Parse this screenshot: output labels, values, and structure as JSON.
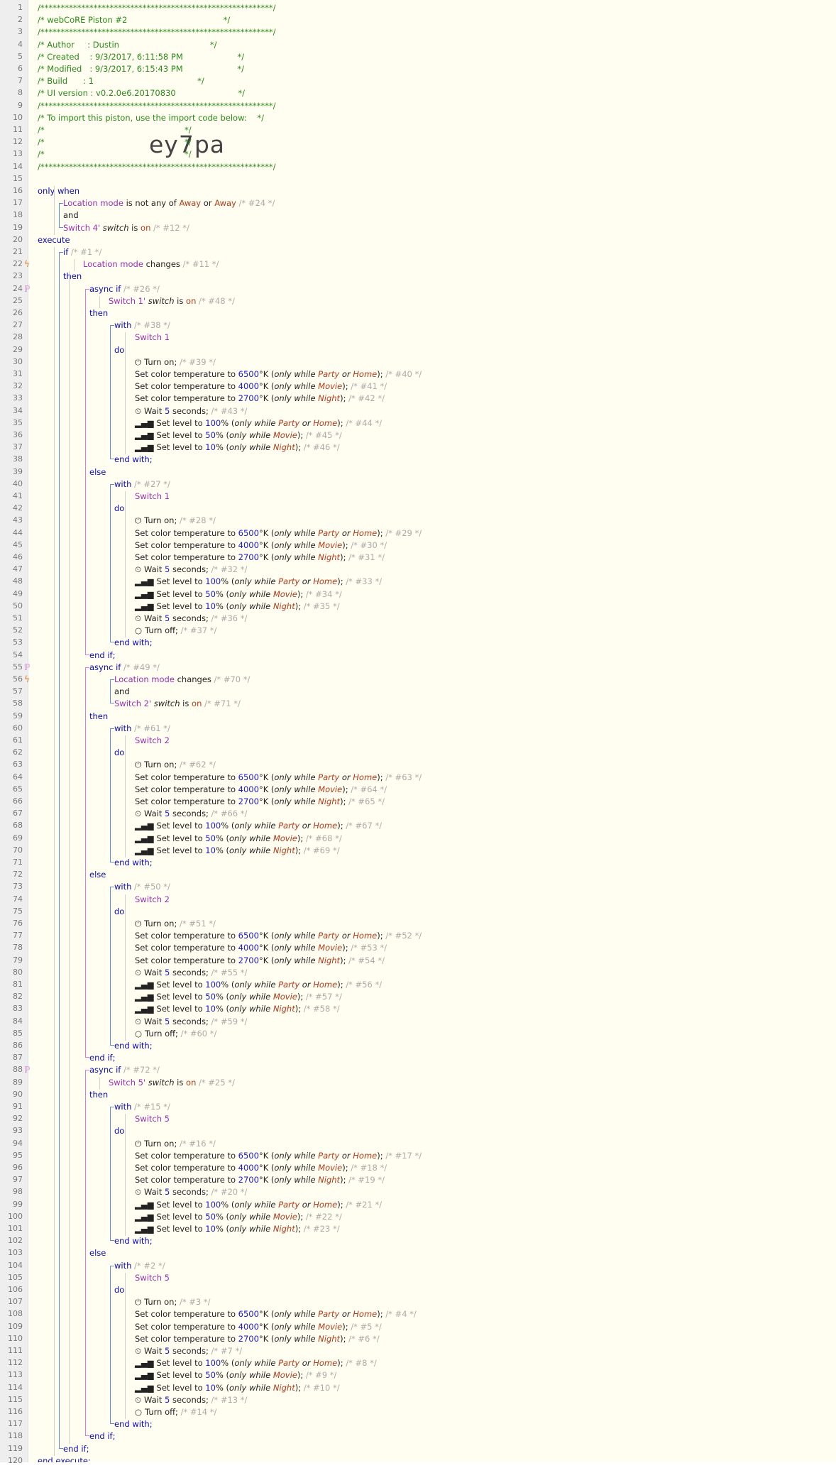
{
  "import_code": "ey7pa",
  "colors": {
    "keyword": "#0a0ab8",
    "device": "#9a2fb2",
    "value": "#b23a1c",
    "comment": "#aaaaaa",
    "header": "#2a8a1a",
    "block": "#5a8fd0",
    "async": "#d87fcf"
  },
  "lines": [
    {
      "n": 1,
      "t": "/*********************************************************/",
      "c": "gr"
    },
    {
      "n": 2,
      "t": "/* webCoRE Piston #2                                     */",
      "c": "gr"
    },
    {
      "n": 3,
      "t": "/*********************************************************/",
      "c": "gr"
    },
    {
      "n": 4,
      "t": "/* Author     : Dustin                                   */",
      "c": "gr"
    },
    {
      "n": 5,
      "t": "/* Created    : 9/3/2017, 6:11:58 PM                     */",
      "c": "gr"
    },
    {
      "n": 6,
      "t": "/* Modified   : 9/3/2017, 6:15:43 PM                     */",
      "c": "gr"
    },
    {
      "n": 7,
      "t": "/* Build      : 1                                        */",
      "c": "gr"
    },
    {
      "n": 8,
      "t": "/* UI version : v0.2.0e6.20170830                        */",
      "c": "gr"
    },
    {
      "n": 9,
      "t": "/*********************************************************/",
      "c": "gr"
    },
    {
      "n": 10,
      "t": "/* To import this piston, use the import code below:    */",
      "c": "gr"
    },
    {
      "n": 11,
      "t": "/*                                                      */",
      "c": "gr"
    },
    {
      "n": 12,
      "t": "/*                                                      */",
      "c": "gr"
    },
    {
      "n": 13,
      "t": "/*                                                      */",
      "c": "gr"
    },
    {
      "n": 14,
      "t": "/*********************************************************/",
      "c": "gr"
    },
    {
      "n": 15,
      "t": ""
    },
    {
      "n": 16,
      "t": "only when",
      "c": "kw"
    },
    {
      "n": 17,
      "t": "Location mode|is not any of|Away|or|Away|/* #24 */"
    },
    {
      "n": 18,
      "t": "and"
    },
    {
      "n": 19,
      "t": "Switch 4' switch|is|on|/* #12 */"
    },
    {
      "n": 20,
      "t": "execute",
      "c": "kw"
    },
    {
      "n": 21,
      "t": "if|/* #1 */"
    },
    {
      "n": 22,
      "t": "Location mode|changes|/* #11 */"
    },
    {
      "n": 23,
      "t": "then",
      "c": "kw"
    },
    {
      "n": 24,
      "t": "async if|/* #26 */"
    },
    {
      "n": 25,
      "t": "Switch 1' switch|is|on|/* #48 */"
    },
    {
      "n": 26,
      "t": "then",
      "c": "kw"
    },
    {
      "n": 27,
      "t": "with|/* #38 */"
    },
    {
      "n": 28,
      "t": "Switch 1",
      "c": "dev"
    },
    {
      "n": 29,
      "t": "do",
      "c": "kw"
    },
    {
      "n": 30,
      "t": "P|Turn on;|/* #39 */"
    },
    {
      "n": 31,
      "t": "CT|6500|Party|Home|/* #40 */"
    },
    {
      "n": 32,
      "t": "CT|4000|Movie||/* #41 */"
    },
    {
      "n": 33,
      "t": "CT|2700|Night||/* #42 */"
    },
    {
      "n": 34,
      "t": "W|5|/* #43 */"
    },
    {
      "n": 35,
      "t": "L|100|Party|Home|/* #44 */"
    },
    {
      "n": 36,
      "t": "L|50|Movie||/* #45 */"
    },
    {
      "n": 37,
      "t": "L|10|Night||/* #46 */"
    },
    {
      "n": 38,
      "t": "end with;",
      "c": "kw"
    },
    {
      "n": 39,
      "t": "else",
      "c": "kw"
    },
    {
      "n": 40,
      "t": "with|/* #27 */"
    },
    {
      "n": 41,
      "t": "Switch 1",
      "c": "dev"
    },
    {
      "n": 42,
      "t": "do",
      "c": "kw"
    },
    {
      "n": 43,
      "t": "P|Turn on;|/* #28 */"
    },
    {
      "n": 44,
      "t": "CT|6500|Party|Home|/* #29 */"
    },
    {
      "n": 45,
      "t": "CT|4000|Movie||/* #30 */"
    },
    {
      "n": 46,
      "t": "CT|2700|Night||/* #31 */"
    },
    {
      "n": 47,
      "t": "W|5|/* #32 */"
    },
    {
      "n": 48,
      "t": "L|100|Party|Home|/* #33 */"
    },
    {
      "n": 49,
      "t": "L|50|Movie||/* #34 */"
    },
    {
      "n": 50,
      "t": "L|10|Night||/* #35 */"
    },
    {
      "n": 51,
      "t": "W|5|/* #36 */"
    },
    {
      "n": 52,
      "t": "O|Turn off;|/* #37 */"
    },
    {
      "n": 53,
      "t": "end with;",
      "c": "kw"
    },
    {
      "n": 54,
      "t": "end if;",
      "c": "kw"
    },
    {
      "n": 55,
      "t": "async if|/* #49 */"
    },
    {
      "n": 56,
      "t": "Location mode|changes|/* #70 */"
    },
    {
      "n": 57,
      "t": "and"
    },
    {
      "n": 58,
      "t": "Switch 2' switch|is|on|/* #71 */"
    },
    {
      "n": 59,
      "t": "then",
      "c": "kw"
    },
    {
      "n": 60,
      "t": "with|/* #61 */"
    },
    {
      "n": 61,
      "t": "Switch 2",
      "c": "dev"
    },
    {
      "n": 62,
      "t": "do",
      "c": "kw"
    },
    {
      "n": 63,
      "t": "P|Turn on;|/* #62 */"
    },
    {
      "n": 64,
      "t": "CT|6500|Party|Home|/* #63 */"
    },
    {
      "n": 65,
      "t": "CT|4000|Movie||/* #64 */"
    },
    {
      "n": 66,
      "t": "CT|2700|Night||/* #65 */"
    },
    {
      "n": 67,
      "t": "W|5|/* #66 */"
    },
    {
      "n": 68,
      "t": "L|100|Party|Home|/* #67 */"
    },
    {
      "n": 69,
      "t": "L|50|Movie||/* #68 */"
    },
    {
      "n": 70,
      "t": "L|10|Night||/* #69 */"
    },
    {
      "n": 71,
      "t": "end with;",
      "c": "kw"
    },
    {
      "n": 72,
      "t": "else",
      "c": "kw"
    },
    {
      "n": 73,
      "t": "with|/* #50 */"
    },
    {
      "n": 74,
      "t": "Switch 2",
      "c": "dev"
    },
    {
      "n": 75,
      "t": "do",
      "c": "kw"
    },
    {
      "n": 76,
      "t": "P|Turn on;|/* #51 */"
    },
    {
      "n": 77,
      "t": "CT|6500|Party|Home|/* #52 */"
    },
    {
      "n": 78,
      "t": "CT|4000|Movie||/* #53 */"
    },
    {
      "n": 79,
      "t": "CT|2700|Night||/* #54 */"
    },
    {
      "n": 80,
      "t": "W|5|/* #55 */"
    },
    {
      "n": 81,
      "t": "L|100|Party|Home|/* #56 */"
    },
    {
      "n": 82,
      "t": "L|50|Movie||/* #57 */"
    },
    {
      "n": 83,
      "t": "L|10|Night||/* #58 */"
    },
    {
      "n": 84,
      "t": "W|5|/* #59 */"
    },
    {
      "n": 85,
      "t": "O|Turn off;|/* #60 */"
    },
    {
      "n": 86,
      "t": "end with;",
      "c": "kw"
    },
    {
      "n": 87,
      "t": "end if;",
      "c": "kw"
    },
    {
      "n": 88,
      "t": "async if|/* #72 */"
    },
    {
      "n": 89,
      "t": "Switch 5' switch|is|on|/* #25 */"
    },
    {
      "n": 90,
      "t": "then",
      "c": "kw"
    },
    {
      "n": 91,
      "t": "with|/* #15 */"
    },
    {
      "n": 92,
      "t": "Switch 5",
      "c": "dev"
    },
    {
      "n": 93,
      "t": "do",
      "c": "kw"
    },
    {
      "n": 94,
      "t": "P|Turn on;|/* #16 */"
    },
    {
      "n": 95,
      "t": "CT|6500|Party|Home|/* #17 */"
    },
    {
      "n": 96,
      "t": "CT|4000|Movie||/* #18 */"
    },
    {
      "n": 97,
      "t": "CT|2700|Night||/* #19 */"
    },
    {
      "n": 98,
      "t": "W|5|/* #20 */"
    },
    {
      "n": 99,
      "t": "L|100|Party|Home|/* #21 */"
    },
    {
      "n": 100,
      "t": "L|50|Movie||/* #22 */"
    },
    {
      "n": 101,
      "t": "L|10|Night||/* #23 */"
    },
    {
      "n": 102,
      "t": "end with;",
      "c": "kw"
    },
    {
      "n": 103,
      "t": "else",
      "c": "kw"
    },
    {
      "n": 104,
      "t": "with|/* #2 */"
    },
    {
      "n": 105,
      "t": "Switch 5",
      "c": "dev"
    },
    {
      "n": 106,
      "t": "do",
      "c": "kw"
    },
    {
      "n": 107,
      "t": "P|Turn on;|/* #3 */"
    },
    {
      "n": 108,
      "t": "CT|6500|Party|Home|/* #4 */"
    },
    {
      "n": 109,
      "t": "CT|4000|Movie||/* #5 */"
    },
    {
      "n": 110,
      "t": "CT|2700|Night||/* #6 */"
    },
    {
      "n": 111,
      "t": "W|5|/* #7 */"
    },
    {
      "n": 112,
      "t": "L|100|Party|Home|/* #8 */"
    },
    {
      "n": 113,
      "t": "L|50|Movie||/* #9 */"
    },
    {
      "n": 114,
      "t": "L|10|Night||/* #10 */"
    },
    {
      "n": 115,
      "t": "W|5|/* #13 */"
    },
    {
      "n": 116,
      "t": "O|Turn off;|/* #14 */"
    },
    {
      "n": 117,
      "t": "end with;",
      "c": "kw"
    },
    {
      "n": 118,
      "t": "end if;",
      "c": "kw"
    },
    {
      "n": 119,
      "t": "end if;",
      "c": "kw"
    },
    {
      "n": 120,
      "t": "end execute;",
      "c": "kw"
    }
  ],
  "text": {
    "ct_prefix": "Set color temperature to ",
    "lv_prefix": "Set level to ",
    "wait_prefix": "Wait ",
    "wait_suffix": " seconds;",
    "only_while": "only while",
    "or": "or",
    "kelvin": "°K (",
    "pct": "% (",
    "close": ");",
    "and": "and",
    "then": "then"
  }
}
